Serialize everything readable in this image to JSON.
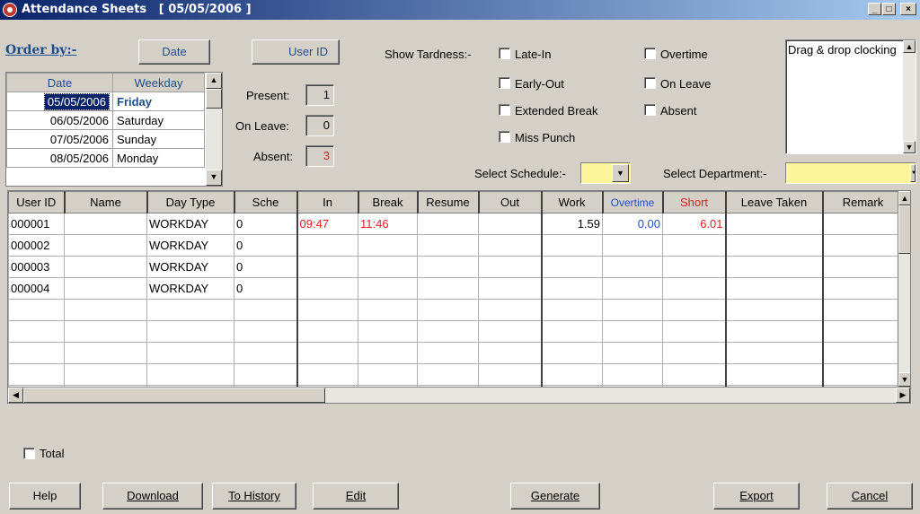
{
  "window": {
    "title": "Attendance Sheets   [ 05/05/2006 ]",
    "minimize_label": "_",
    "restore_label": "□",
    "close_label": "×"
  },
  "order_by": {
    "label": "Order by:-",
    "date_button": "Date",
    "userid_button": "User ID"
  },
  "date_list": {
    "headers": [
      "Date",
      "Weekday"
    ],
    "rows": [
      {
        "date": "05/05/2006",
        "weekday": "Friday"
      },
      {
        "date": "06/05/2006",
        "weekday": "Saturday"
      },
      {
        "date": "07/05/2006",
        "weekday": "Sunday"
      },
      {
        "date": "08/05/2006",
        "weekday": "Monday"
      }
    ]
  },
  "counts": {
    "present_label": "Present:",
    "present_value": "1",
    "onleave_label": "On Leave:",
    "onleave_value": "0",
    "absent_label": "Absent:",
    "absent_value": "3"
  },
  "tardiness": {
    "label": "Show Tardness:-",
    "options": [
      "Late-In",
      "Early-Out",
      "Extended Break",
      "Miss Punch"
    ],
    "right_options": [
      "Overtime",
      "On Leave",
      "Absent"
    ]
  },
  "drag_box_text": "Drag & drop clocking",
  "select_schedule_label": "Select Schedule:-",
  "select_department_label": "Select Department:-",
  "grid": {
    "headers": [
      "User ID",
      "Name",
      "Day Type",
      "Sche",
      "In",
      "Break",
      "Resume",
      "Out",
      "Work",
      "Overtime",
      "Short",
      "Leave Taken",
      "Remark"
    ],
    "rows": [
      {
        "userid": "000001",
        "name": "",
        "daytype": "WORKDAY",
        "sche": "0",
        "in": "09:47",
        "break": "11:46",
        "resume": "",
        "out": "",
        "work": "1.59",
        "overtime": "0.00",
        "short": "6.01",
        "leave": "",
        "remark": ""
      },
      {
        "userid": "000002",
        "name": "",
        "daytype": "WORKDAY",
        "sche": "0",
        "in": "",
        "break": "",
        "resume": "",
        "out": "",
        "work": "",
        "overtime": "",
        "short": "",
        "leave": "",
        "remark": ""
      },
      {
        "userid": "000003",
        "name": "",
        "daytype": "WORKDAY",
        "sche": "0",
        "in": "",
        "break": "",
        "resume": "",
        "out": "",
        "work": "",
        "overtime": "",
        "short": "",
        "leave": "",
        "remark": ""
      },
      {
        "userid": "000004",
        "name": "",
        "daytype": "WORKDAY",
        "sche": "0",
        "in": "",
        "break": "",
        "resume": "",
        "out": "",
        "work": "",
        "overtime": "",
        "short": "",
        "leave": "",
        "remark": ""
      }
    ]
  },
  "total_label": "Total",
  "buttons": {
    "help": "Help",
    "download": "Download",
    "to_history": "To History",
    "edit": "Edit",
    "generate": "Generate",
    "export": "Export",
    "cancel": "Cancel"
  },
  "colors": {
    "title_start": "#0a246a",
    "title_end": "#a6caf0",
    "accent_blue": "#1f4e8c",
    "alert_red": "#e02020",
    "highlight_yellow": "#fdf59b"
  }
}
